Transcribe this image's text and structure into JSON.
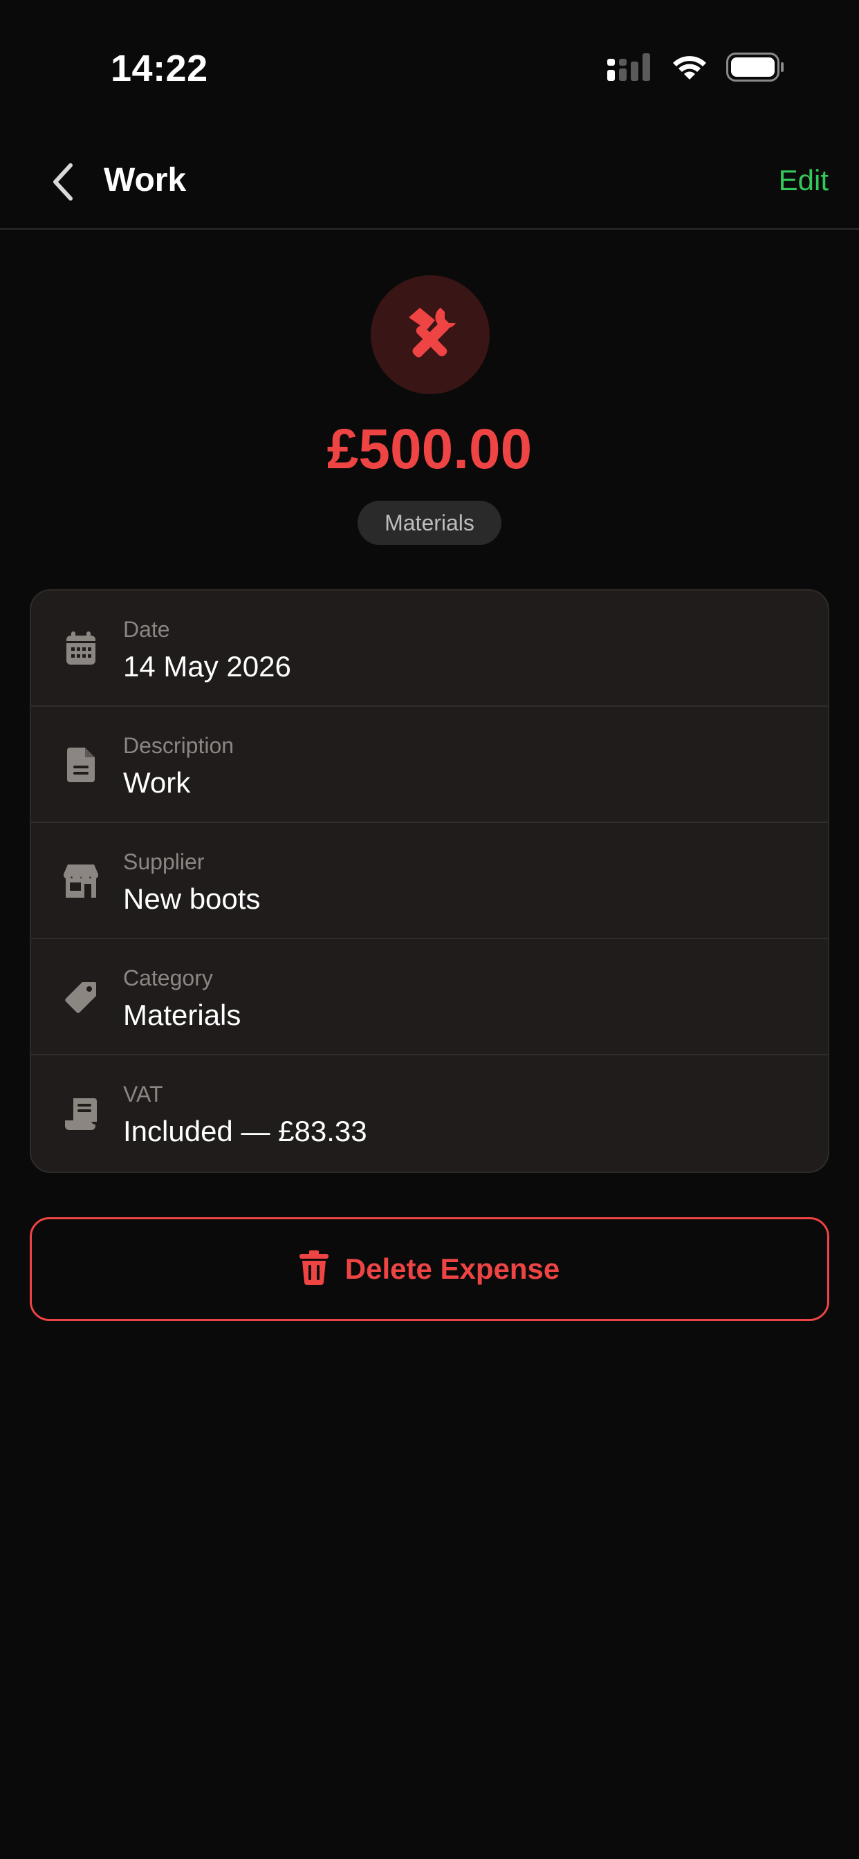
{
  "status_bar": {
    "time": "14:22",
    "icons": [
      "cellular-signal-icon",
      "wifi-icon",
      "battery-icon"
    ]
  },
  "nav": {
    "back_icon": "chevron-left-icon",
    "title": "Work",
    "edit_label": "Edit"
  },
  "expense": {
    "icon": "tools-icon",
    "amount": "£500.00",
    "category_tag": "Materials"
  },
  "details": {
    "items": [
      {
        "icon": "calendar-icon",
        "label": "Date",
        "value": "14 May 2026"
      },
      {
        "icon": "document-icon",
        "label": "Description",
        "value": "Work"
      },
      {
        "icon": "store-icon",
        "label": "Supplier",
        "value": "New boots"
      },
      {
        "icon": "tag-icon",
        "label": "Category",
        "value": "Materials"
      },
      {
        "icon": "receipt-icon",
        "label": "VAT",
        "value": "Included — £83.33"
      }
    ]
  },
  "actions": {
    "delete_label": "Delete Expense",
    "delete_icon": "trash-icon"
  },
  "colors": {
    "background": "#0a0a0a",
    "accent_red": "#ef4444",
    "accent_green": "#34c759",
    "card": "#1f1c1b"
  }
}
